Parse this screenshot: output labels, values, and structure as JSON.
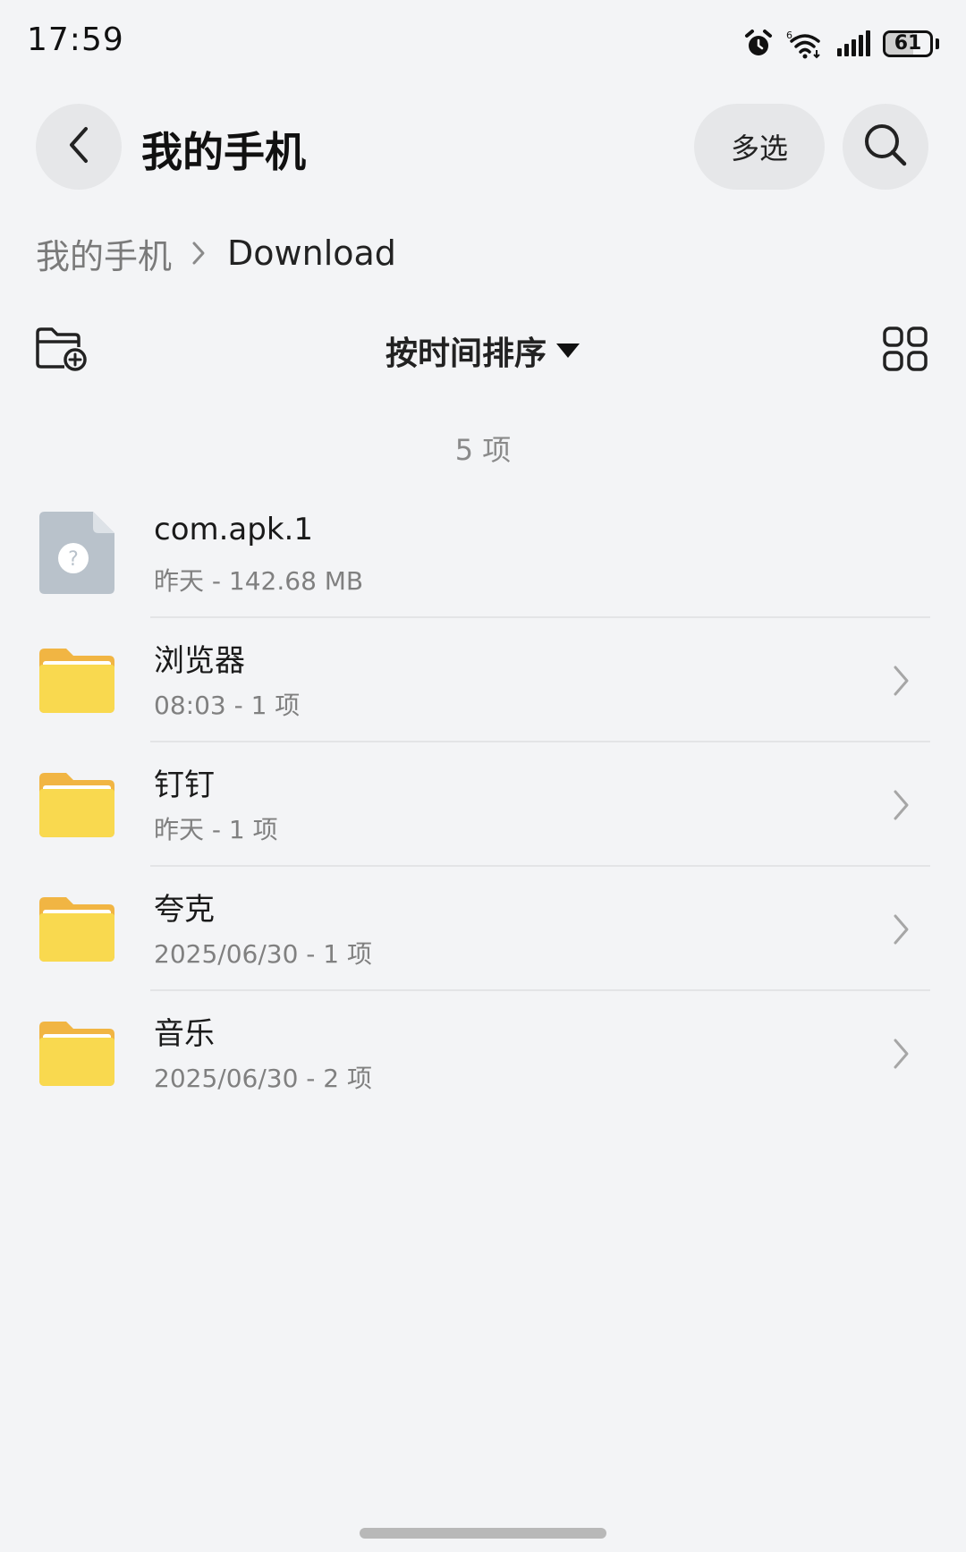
{
  "status_bar": {
    "time": "17:59",
    "battery_level": "61",
    "battery_fraction": 0.61,
    "icons": [
      "alarm-icon",
      "wifi-icon",
      "signal-icon",
      "battery-icon"
    ]
  },
  "header": {
    "title": "我的手机",
    "multiselect_label": "多选"
  },
  "breadcrumb": {
    "root": "我的手机",
    "current": "Download"
  },
  "toolbar": {
    "sort_label": "按时间排序"
  },
  "list": {
    "count_label": "5 项",
    "items": [
      {
        "name": "com.apk.1",
        "meta": "昨天 - 142.68 MB",
        "type": "file",
        "icon": "unknown-file-icon"
      },
      {
        "name": "浏览器",
        "meta": "08:03 - 1 项",
        "type": "folder",
        "icon": "folder-icon"
      },
      {
        "name": "钉钉",
        "meta": "昨天 - 1 项",
        "type": "folder",
        "icon": "folder-icon"
      },
      {
        "name": "夸克",
        "meta": "2025/06/30 - 1 项",
        "type": "folder",
        "icon": "folder-icon"
      },
      {
        "name": "音乐",
        "meta": "2025/06/30 - 2 项",
        "type": "folder",
        "icon": "folder-icon"
      }
    ]
  },
  "colors": {
    "background": "#f3f4f6",
    "button_bg": "#e6e7e9",
    "folder_yellow": "#f9d94f",
    "folder_tab": "#f1b543",
    "file_gray": "#b8c1ca",
    "secondary_text": "#808080"
  }
}
